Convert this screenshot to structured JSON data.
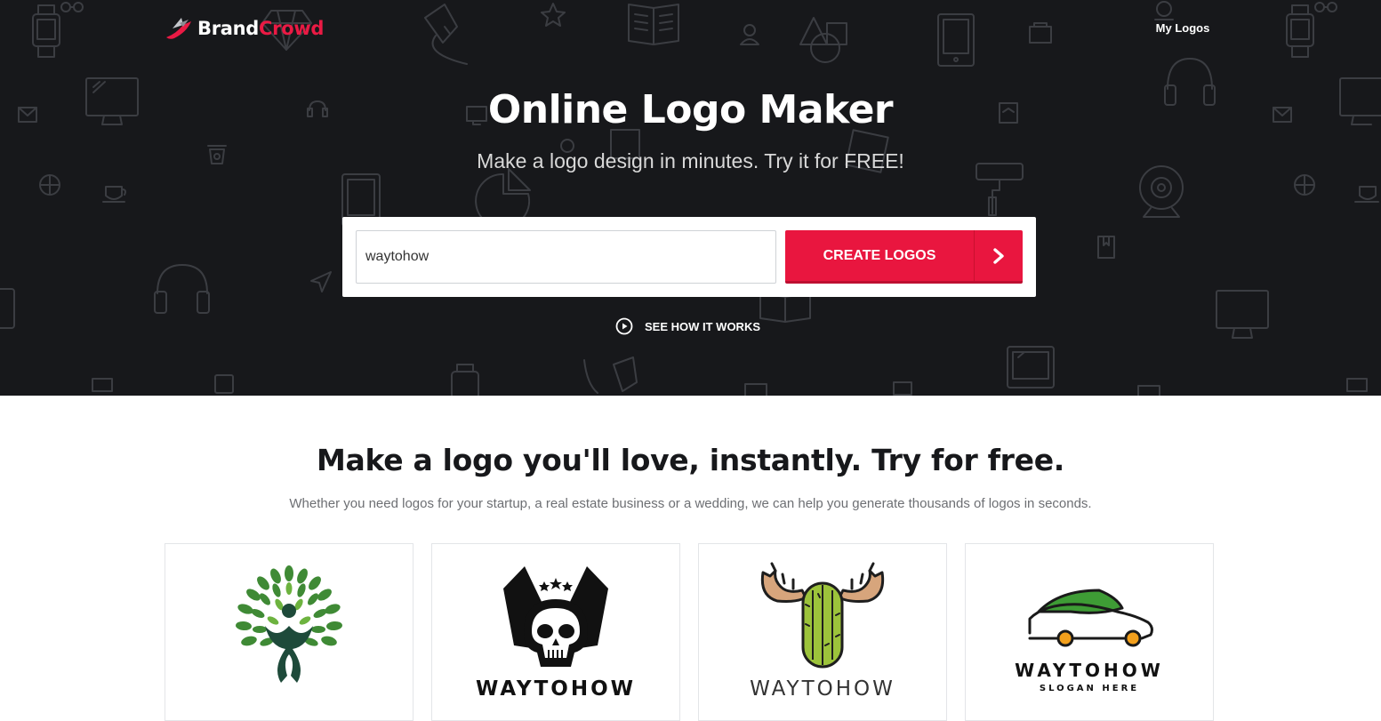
{
  "header": {
    "brand_part1": "Brand",
    "brand_part2": "Crowd",
    "brand_logo_icon": "brand-swoosh-icon",
    "my_logos_label": "My Logos"
  },
  "hero": {
    "title": "Online Logo Maker",
    "subtitle": "Make a logo design in minutes. Try it for FREE!",
    "search_value": "waytohow",
    "create_button_label": "CREATE LOGOS",
    "create_button_icon": "chevron-right-icon",
    "how_it_works_label": "SEE HOW IT WORKS",
    "how_it_works_icon": "play-circle-icon"
  },
  "section": {
    "title": "Make a logo you'll love, instantly. Try for free.",
    "subtitle": "Whether you need logos for your startup, a real estate business or a wedding, we can help you generate thousands of logos in seconds."
  },
  "logo_cards": [
    {
      "icon": "tree-person-icon",
      "name": ""
    },
    {
      "icon": "winged-skull-icon",
      "name": "WAYTOHOW"
    },
    {
      "icon": "cactus-moose-icon",
      "name": "WAYTOHOW"
    },
    {
      "icon": "car-icon",
      "name": "WAYTOHOW",
      "slogan": "SLOGAN HERE"
    }
  ],
  "colors": {
    "hero_background": "#17181b",
    "accent_red": "#e9163f",
    "leaf_green": "#3f8a35",
    "cactus_green": "#9cc33b",
    "antler_tan": "#d7a57c",
    "car_green": "#3e9c35",
    "wheel_orange": "#f3a01c"
  }
}
